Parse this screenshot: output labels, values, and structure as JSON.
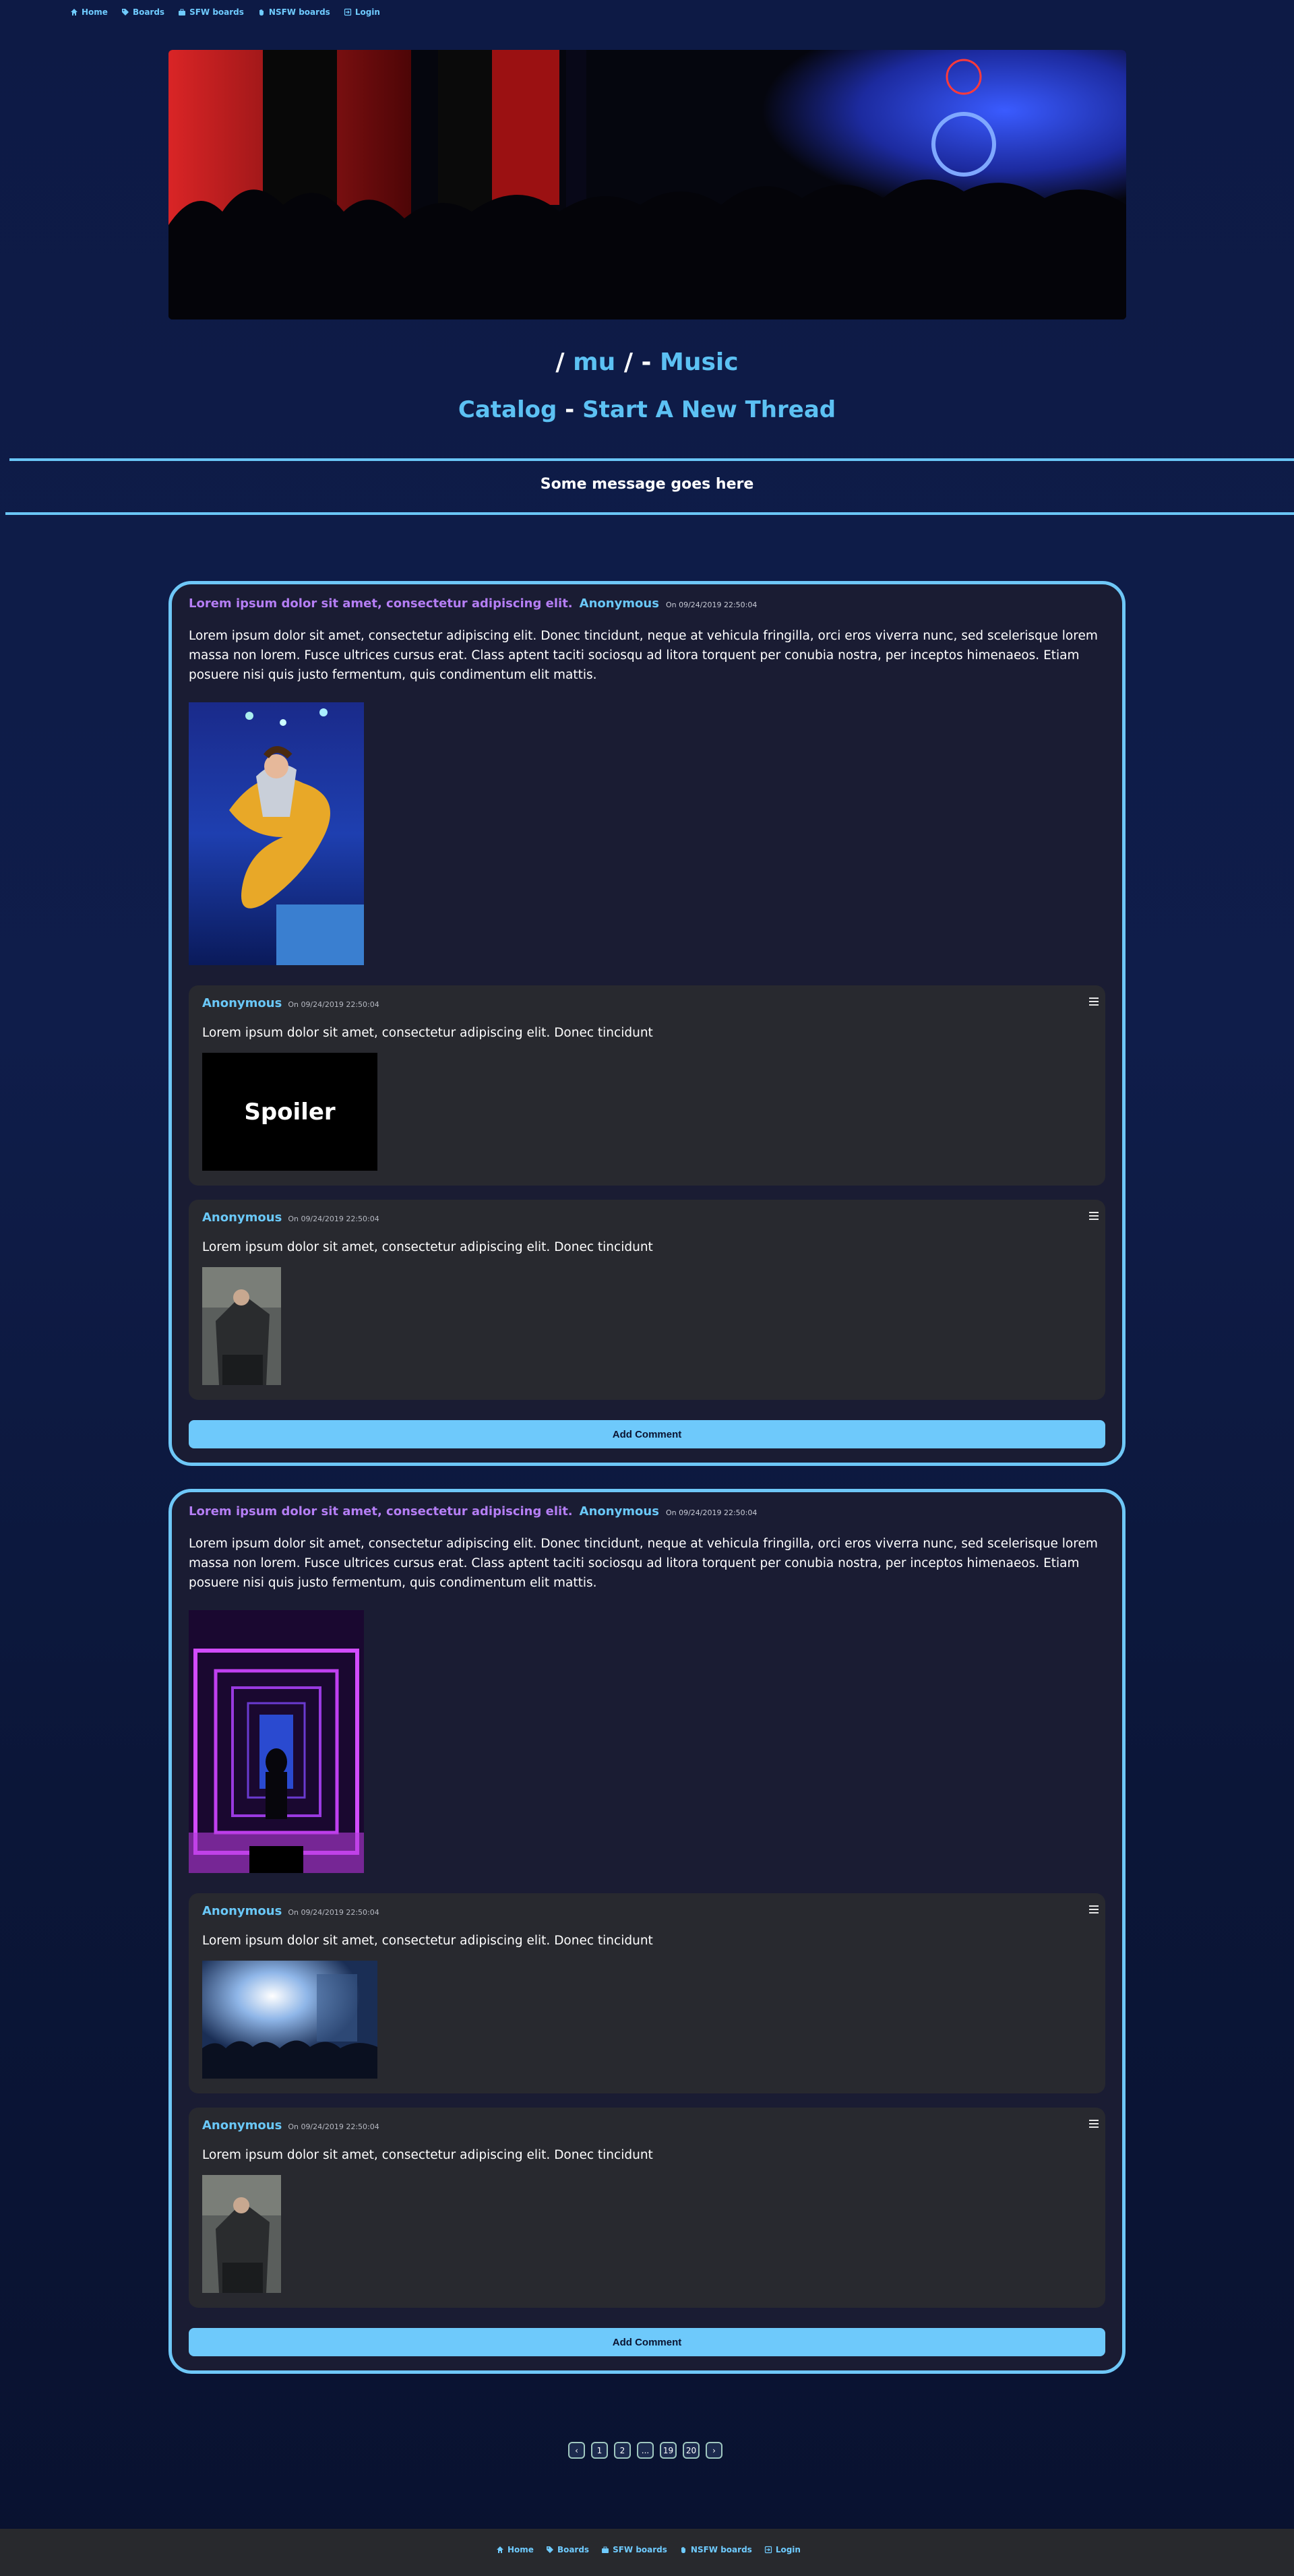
{
  "nav": {
    "items": [
      {
        "label": "Home",
        "icon": "home-icon"
      },
      {
        "label": "Boards",
        "icon": "tag-icon"
      },
      {
        "label": "SFW boards",
        "icon": "briefcase-icon"
      },
      {
        "label": "NSFW boards",
        "icon": "hand-icon"
      },
      {
        "label": "Login",
        "icon": "login-icon"
      }
    ]
  },
  "board": {
    "slash_open": "/",
    "code": "mu",
    "slash_close": "/",
    "dash": "-",
    "name": "Music",
    "catalog_label": "Catalog",
    "separator": "-",
    "new_thread_label": "Start A New Thread"
  },
  "message": "Some message goes here",
  "threads": [
    {
      "subject": "Lorem ipsum dolor sit amet, consectetur adipiscing elit.",
      "author": "Anonymous",
      "date": "On 09/24/2019 22:50:04",
      "body": "Lorem ipsum dolor sit amet, consectetur adipiscing elit. Donec tincidunt, neque at vehicula fringilla, orci eros viverra nunc, sed scelerisque lorem massa non lorem. Fusce ultrices cursus erat. Class aptent taciti sociosqu ad litora torquent per conubia nostra, per inceptos himenaeos. Etiam posuere nisi quis justo fermentum, quis condimentum elit mattis.",
      "replies": [
        {
          "author": "Anonymous",
          "date": "On 09/24/2019 22:50:04",
          "body": "Lorem ipsum dolor sit amet, consectetur adipiscing elit. Donec tincidunt",
          "spoiler_label": "Spoiler"
        },
        {
          "author": "Anonymous",
          "date": "On 09/24/2019 22:50:04",
          "body": "Lorem ipsum dolor sit amet, consectetur adipiscing elit. Donec tincidunt"
        }
      ],
      "add_comment": "Add Comment"
    },
    {
      "subject": "Lorem ipsum dolor sit amet, consectetur adipiscing elit.",
      "author": "Anonymous",
      "date": "On 09/24/2019 22:50:04",
      "body": "Lorem ipsum dolor sit amet, consectetur adipiscing elit. Donec tincidunt, neque at vehicula fringilla, orci eros viverra nunc, sed scelerisque lorem massa non lorem. Fusce ultrices cursus erat. Class aptent taciti sociosqu ad litora torquent per conubia nostra, per inceptos himenaeos. Etiam posuere nisi quis justo fermentum, quis condimentum elit mattis.",
      "replies": [
        {
          "author": "Anonymous",
          "date": "On 09/24/2019 22:50:04",
          "body": "Lorem ipsum dolor sit amet, consectetur adipiscing elit. Donec tincidunt"
        },
        {
          "author": "Anonymous",
          "date": "On 09/24/2019 22:50:04",
          "body": "Lorem ipsum dolor sit amet, consectetur adipiscing elit. Donec tincidunt"
        }
      ],
      "add_comment": "Add Comment"
    }
  ],
  "pagination": {
    "prev": "‹",
    "pages": [
      "1",
      "2",
      "...",
      "19",
      "20"
    ],
    "next": "›"
  },
  "colors": {
    "accent": "#6ec7f7",
    "subject": "#b57ef5",
    "author": "#6ac8f8"
  }
}
